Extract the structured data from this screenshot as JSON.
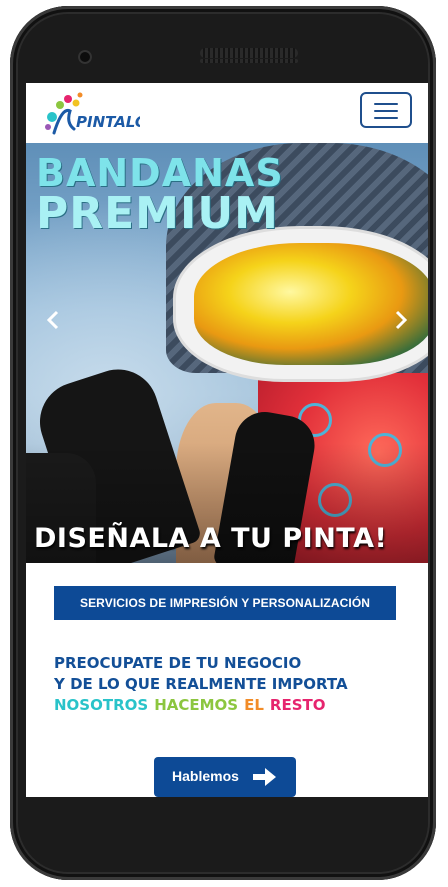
{
  "header": {
    "logo_text": "PINTALO",
    "menu_icon": "hamburger-menu-icon"
  },
  "hero": {
    "title_line1": "BANDANAS",
    "title_line2": "PREMIUM",
    "tagline": "DISEÑALA A TU PINTA!",
    "prev_icon": "chevron-left-icon",
    "next_icon": "chevron-right-icon"
  },
  "services": {
    "label": "SERVICIOS DE IMPRESIÓN Y PERSONALIZACIÓN"
  },
  "slogan": {
    "line1": "PREOCUPATE DE TU NEGOCIO",
    "line2": "Y DE LO QUE REALMENTE IMPORTA",
    "line3_words": [
      {
        "text": "NOSOTROS",
        "color": "#29c3c9"
      },
      {
        "text": "HACEMOS",
        "color": "#8cc63f"
      },
      {
        "text": "EL",
        "color": "#f28c28"
      },
      {
        "text": "RESTO",
        "color": "#e6246e"
      }
    ]
  },
  "cta": {
    "label": "Hablemos",
    "icon": "arrow-right-icon"
  },
  "colors": {
    "brand_blue": "#0d4a96",
    "text_blue": "#134f97",
    "phone_body": "#1b1b1b"
  }
}
